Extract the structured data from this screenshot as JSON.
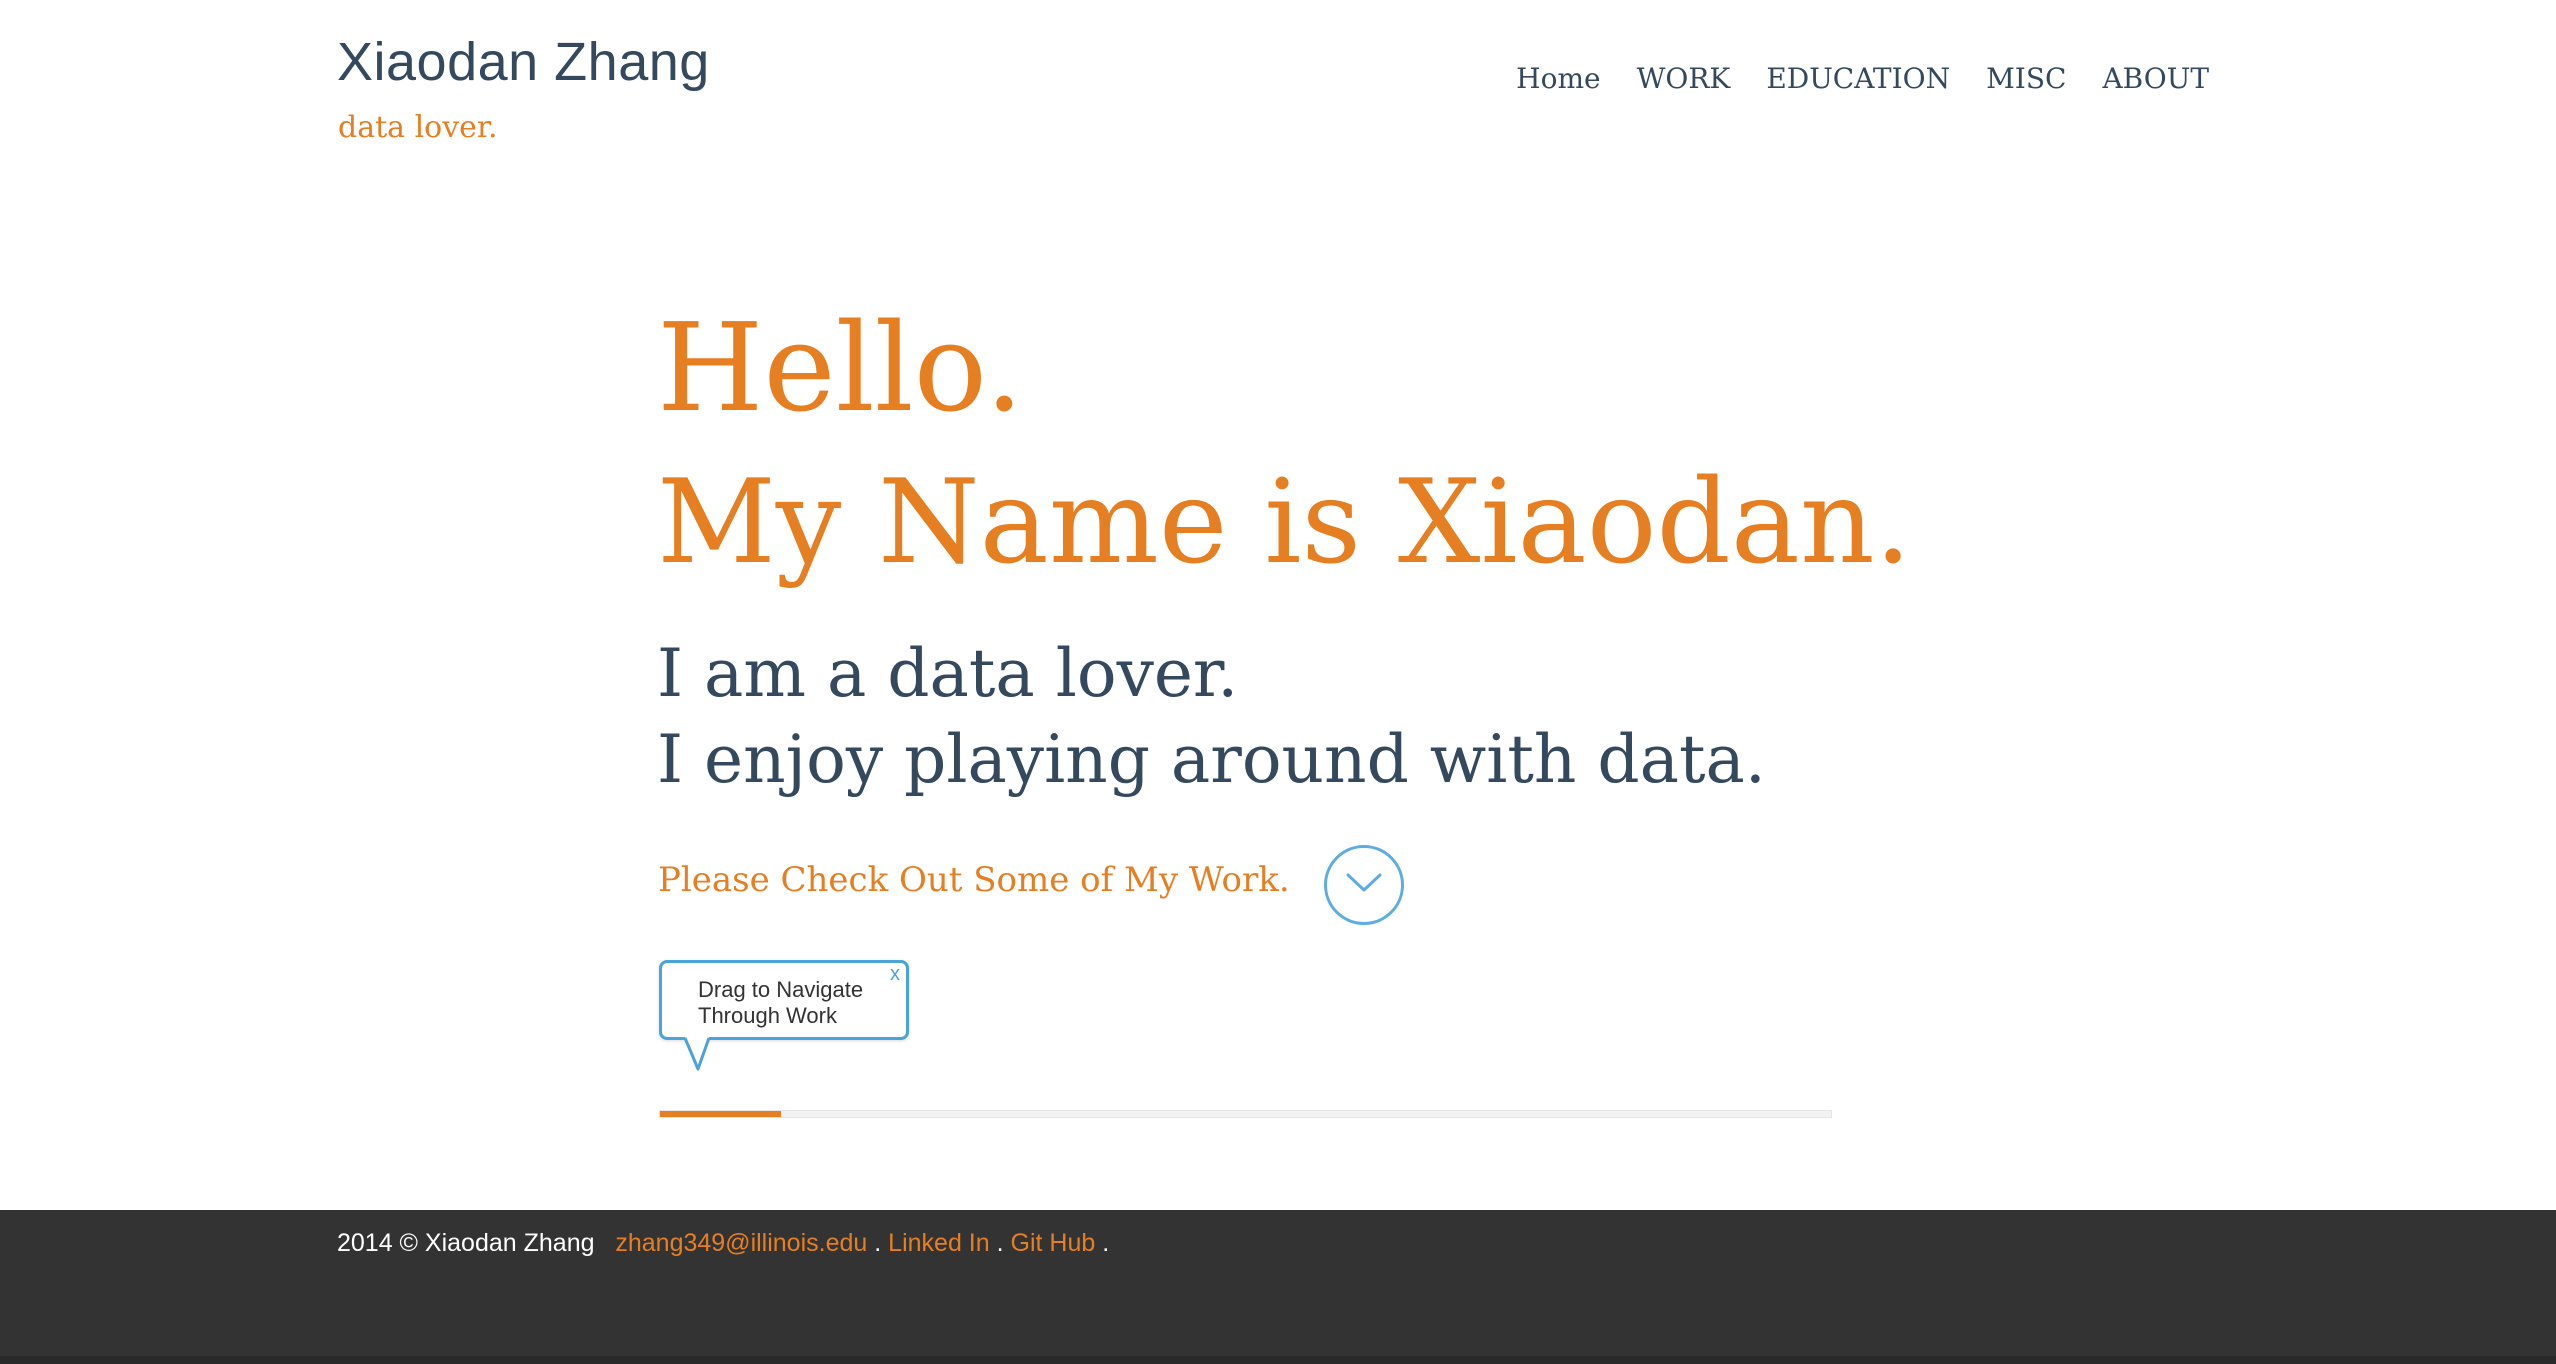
{
  "header": {
    "title": "Xiaodan Zhang",
    "tagline": "data lover."
  },
  "nav": {
    "items": [
      "Home",
      "WORK",
      "EDUCATION",
      "MISC",
      "ABOUT"
    ]
  },
  "hero": {
    "greeting": "Hello.",
    "name_line": "My Name is Xiaodan.",
    "line1": "I am a data lover.",
    "line2": "I enjoy playing around with data.",
    "cta_label": "Please Check Out Some of My Work.",
    "cta_icon": "chevron-down-circle-icon"
  },
  "tooltip": {
    "line1": "Drag to Navigate",
    "line2": "Through Work",
    "close_label": "x"
  },
  "slider": {
    "progress": 0.103
  },
  "footer": {
    "copyright": "2014 © Xiaodan Zhang",
    "email": "zhang349@illinois.edu",
    "sep1": ".",
    "linkedin": "Linked In",
    "sep2": ".",
    "github": "Git Hub",
    "sep3": "."
  },
  "colors": {
    "accent": "#e67e22",
    "text_dark": "#34495e",
    "link_blue": "#4ba3d9",
    "footer_bg": "#333333"
  }
}
